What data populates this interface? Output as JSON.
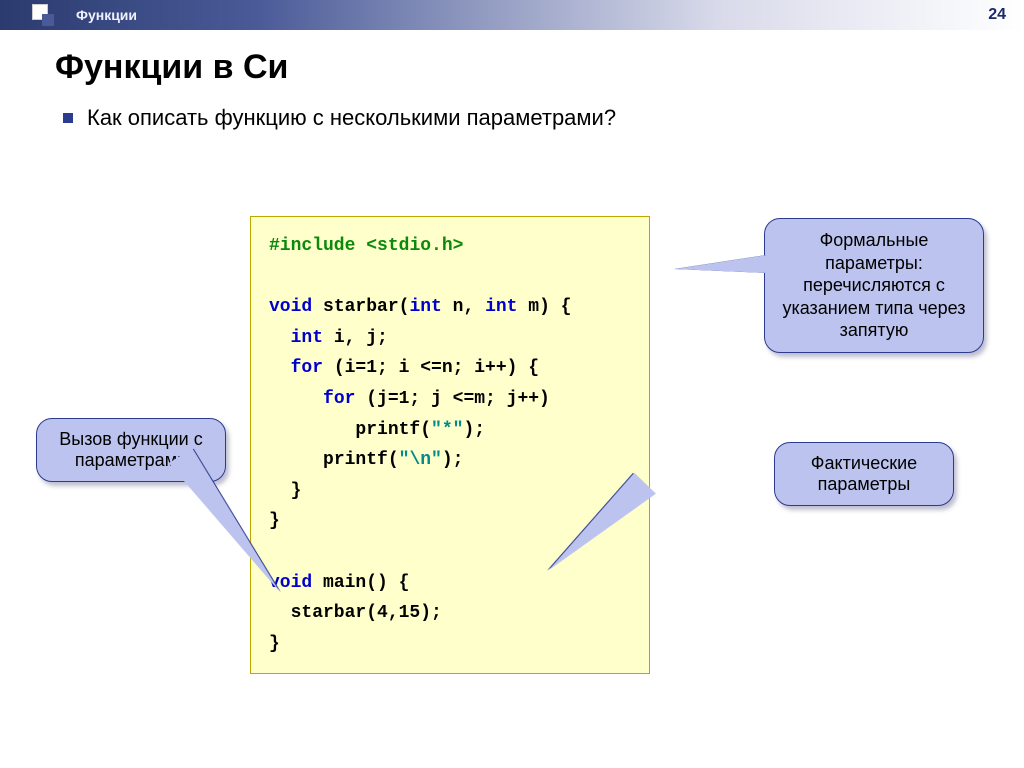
{
  "slide": {
    "breadcrumb": "Функции",
    "number": "24",
    "title": "Функции в Си",
    "bullet": "Как описать функцию с несколькими параметрами?"
  },
  "code": {
    "include_kw": "#include",
    "include_hdr": "<stdio.h>",
    "void1": "void",
    "fn1_name": " starbar(",
    "int1": "int",
    "p1": " n, ",
    "int2": "int",
    "p2": " m) {",
    "int3": "int",
    "decl": " i, j;",
    "for1": "for",
    "for1_rest": " (i=1; i <=n; i++) {",
    "for2": "for",
    "for2_rest": " (j=1; j <=m; j++)",
    "printf1_call": "printf(",
    "printf1_str": "\"*\"",
    "printf1_end": ");",
    "printf2_call": "printf(",
    "printf2_str": "\"\\n\"",
    "printf2_end": ");",
    "brace1": "}",
    "brace2": "}",
    "void2": "void",
    "main_sig": " main() {",
    "main_call": "  starbar(4,15);",
    "brace3": "}"
  },
  "callouts": {
    "formal": "Формальные параметры: перечисляются с указанием типа через запятую",
    "actual": "Фактические параметры",
    "call": "Вызов функции с параметрами"
  }
}
